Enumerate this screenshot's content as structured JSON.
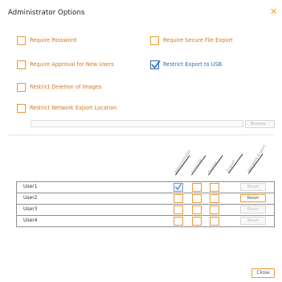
{
  "dialog": {
    "title": "Administrator Options",
    "close_glyph": "✕",
    "close_icon": "close-icon",
    "accent_color": "#e89a3c",
    "link_color": "#2f68b5"
  },
  "options": {
    "left": [
      {
        "label": "Require Password",
        "checked": false
      },
      {
        "label": "Require Approval for New Users",
        "checked": false
      },
      {
        "label": "Restrict Deletion of Images",
        "checked": false
      },
      {
        "label": "Restrict Network Export Location",
        "checked": false
      }
    ],
    "right": [
      {
        "label": "Require Secure File Export",
        "checked": false
      },
      {
        "label": "Restrict Export to USB",
        "checked": true
      }
    ]
  },
  "export_location": {
    "value": "",
    "browse_label": "Browse..."
  },
  "columns": [
    "Administrator",
    "Approve",
    "Delete",
    "Export",
    "Network Export"
  ],
  "users": [
    {
      "name": "User1",
      "perms": [
        true,
        false,
        false
      ],
      "reset_label": "Reset",
      "reset_enabled": false
    },
    {
      "name": "User2",
      "perms": [
        false,
        false,
        false
      ],
      "reset_label": "Reset",
      "reset_enabled": true
    },
    {
      "name": "User3",
      "perms": [
        false,
        false,
        false
      ],
      "reset_label": "Reset",
      "reset_enabled": false
    },
    {
      "name": "User4",
      "perms": [
        false,
        false,
        false
      ],
      "reset_label": "Reset",
      "reset_enabled": false
    }
  ],
  "footer": {
    "close_label": "Close"
  }
}
